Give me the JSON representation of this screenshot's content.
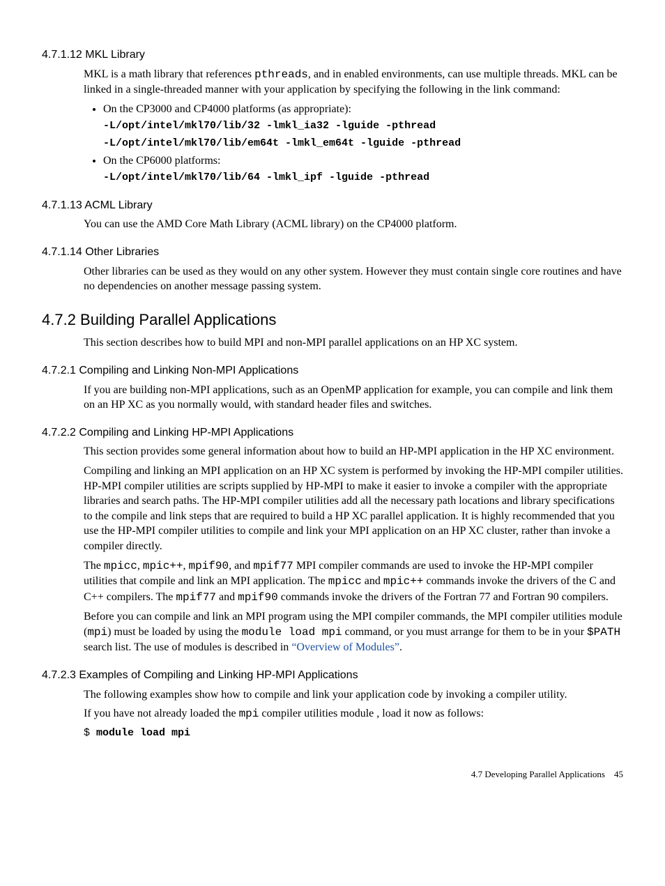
{
  "s47112": {
    "heading": "4.7.1.12 MKL Library",
    "p1_a": "MKL is a math library that references ",
    "p1_b": "pthreads",
    "p1_c": ", and in enabled environments, can use multiple threads. MKL can be linked in a single-threaded manner with your application by specifying the following in the link command:",
    "bullet1": "On the CP3000 and CP4000 platforms (as appropriate):",
    "code1a": "-L/opt/intel/mkl70/lib/32 -lmkl_ia32 -lguide -pthread",
    "code1b": "-L/opt/intel/mkl70/lib/em64t -lmkl_em64t -lguide -pthread",
    "bullet2": "On the CP6000 platforms:",
    "code2": "-L/opt/intel/mkl70/lib/64 -lmkl_ipf -lguide -pthread"
  },
  "s47113": {
    "heading": "4.7.1.13 ACML Library",
    "p1": "You can use the AMD Core Math Library (ACML library) on the CP4000 platform."
  },
  "s47114": {
    "heading": "4.7.1.14 Other Libraries",
    "p1": "Other libraries can be used as they would on any other system. However they must contain single core routines and have no dependencies on another message passing system."
  },
  "s472": {
    "heading": "4.7.2 Building Parallel Applications",
    "p1": "This section describes how to build MPI and non-MPI parallel applications on an HP XC system."
  },
  "s4721": {
    "heading": "4.7.2.1 Compiling and Linking Non-MPI Applications",
    "p1": "If you are building non-MPI applications, such as an OpenMP application for example, you can compile and link them on an HP XC as you normally would, with standard header files and switches."
  },
  "s4722": {
    "heading": "4.7.2.2 Compiling and Linking HP-MPI Applications",
    "p1": "This section provides some general information about how to build an HP-MPI application in the HP XC environment.",
    "p2": "Compiling and linking an MPI application on an HP XC system is performed by invoking the HP-MPI compiler utilities. HP-MPI compiler utilities are scripts supplied by HP-MPI to make it easier to invoke a compiler with the appropriate libraries and search paths. The HP-MPI compiler utilities add all the necessary path locations and library specifications to the compile and link steps that are required to build a HP XC parallel application. It is highly recommended that you use the HP-MPI compiler utilities to compile and link your MPI application on an HP XC cluster, rather than invoke a compiler directly.",
    "p3_a": "The ",
    "p3_b": "mpicc",
    "p3_c": ", ",
    "p3_d": "mpic++",
    "p3_e": ", ",
    "p3_f": "mpif90",
    "p3_g": ", and ",
    "p3_h": "mpif77",
    "p3_i": " MPI compiler commands are used to invoke the HP-MPI compiler utilities that compile and link an MPI application. The ",
    "p3_j": "mpicc",
    "p3_k": " and ",
    "p3_l": "mpic++",
    "p3_m": " commands invoke the drivers of the C and C++ compilers. The ",
    "p3_n": "mpif77",
    "p3_o": " and ",
    "p3_p": "mpif90",
    "p3_q": " commands invoke the drivers of the Fortran 77 and Fortran 90 compilers.",
    "p4_a": "Before you can compile and link an MPI program using the MPI compiler commands, the MPI compiler utilities module (",
    "p4_b": "mpi",
    "p4_c": ") must be loaded by using the ",
    "p4_d": "module load mpi",
    "p4_e": " command, or you must arrange for them to be in your ",
    "p4_f": "$PATH",
    "p4_g": " search list. The use of modules is described in ",
    "p4_link": "“Overview of Modules”",
    "p4_h": "."
  },
  "s4723": {
    "heading": "4.7.2.3 Examples of Compiling and Linking HP-MPI Applications",
    "p1": "The following examples show how to compile and link your application code by invoking a compiler utility.",
    "p2_a": "If you have not already loaded the ",
    "p2_b": "mpi",
    "p2_c": " compiler utilities module , load it now as follows:",
    "shell_prompt": "$ ",
    "shell_cmd": "module load mpi"
  },
  "footer": {
    "section": "4.7 Developing Parallel Applications",
    "page": "45"
  }
}
